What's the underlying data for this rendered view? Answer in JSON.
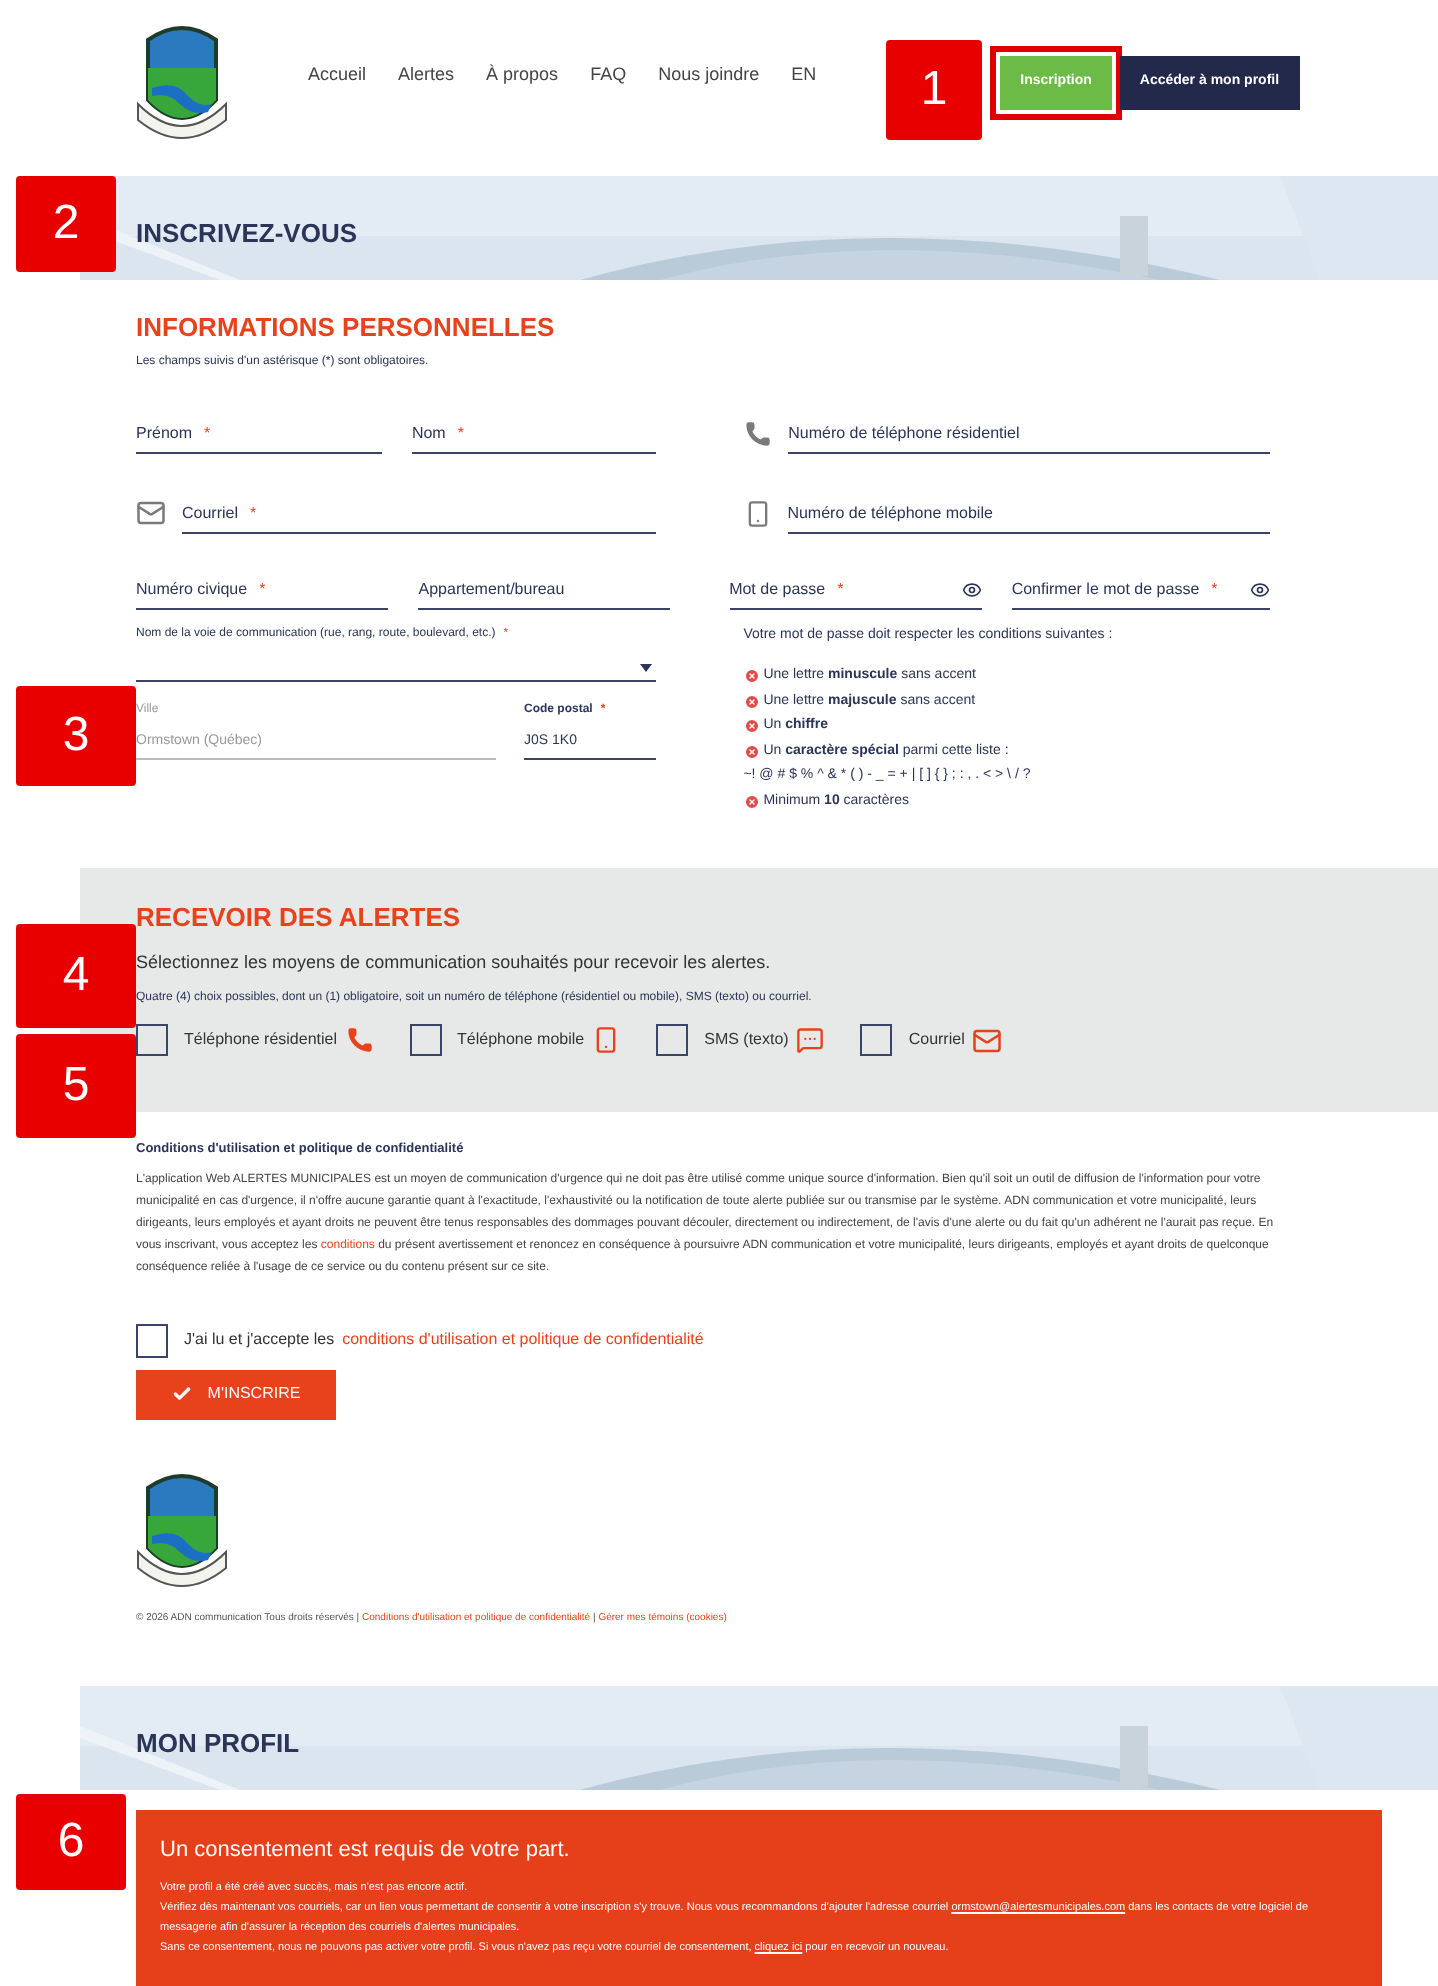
{
  "nav": {
    "items": [
      "Accueil",
      "Alertes",
      "À propos",
      "FAQ",
      "Nous joindre",
      "EN"
    ],
    "buttons": [
      {
        "label": "Inscription",
        "kind": "primary"
      },
      {
        "label": "Accéder à mon profil",
        "kind": "dark"
      }
    ]
  },
  "callouts": [
    "1",
    "2",
    "3",
    "4",
    "5",
    "6"
  ],
  "signup_banner": {
    "title": "INSCRIVEZ-VOUS"
  },
  "personal": {
    "title": "INFORMATIONS PERSONNELLES",
    "note": "Les champs suivis d'un astérisque (*) sont obligatoires.",
    "fields": [
      {
        "label": "Prénom",
        "mark": "*"
      },
      {
        "label": "Nom",
        "mark": "*"
      },
      {
        "label": "Numéro de téléphone résidentiel"
      },
      {
        "label": "Courriel",
        "mark": "*"
      },
      {
        "label": "Numéro de téléphone mobile"
      },
      {
        "label": "Numéro civique",
        "mark": "*"
      },
      {
        "label": "Appartement/bureau"
      },
      {
        "label": "Mot de passe",
        "mark": "*"
      },
      {
        "label": "Confirmer le mot de passe",
        "mark": "*"
      }
    ],
    "street": {
      "label": "Nom de la voie de communication (rue, rang, route, boulevard, etc.)",
      "mark": "*"
    },
    "city": {
      "label": "Ville",
      "value": "Ormstown (Québec)",
      "disabled": true
    },
    "postal": {
      "label": "Code postal",
      "mark": "*",
      "value": "J0S 1K0",
      "disabled": false
    },
    "password_rules": {
      "title": "Votre mot de passe doit respecter les conditions suivantes :",
      "rules": [
        {
          "text": "Une lettre **minuscule** sans accent"
        },
        {
          "text": "Une lettre **majuscule** sans accent"
        },
        {
          "text": "Un **chiffre**"
        },
        {
          "text": "Un **caractère spécial** parmi cette liste :",
          "extra": "~! @ # $ % ^ & * ( ) - _ = + | [ ] { } ; : , . < > \\ / ?"
        },
        {
          "text": "Minimum **10** caractères"
        }
      ]
    }
  },
  "alerts": {
    "title": "RECEVOIR DES ALERTES",
    "intro": "Sélectionnez les moyens de communication souhaités pour recevoir les alertes.",
    "note": "Quatre (4) choix possibles, dont un (1) obligatoire, soit un numéro de téléphone (résidentiel ou mobile), SMS (texto) ou courriel.",
    "options": [
      {
        "label": "Téléphone résidentiel",
        "checked": false
      },
      {
        "label": "Téléphone mobile",
        "checked": false
      },
      {
        "label": "SMS (texto)",
        "checked": false
      },
      {
        "label": "Courriel",
        "checked": false
      }
    ]
  },
  "terms": {
    "title": "Conditions d'utilisation et politique de confidentialité",
    "paragraph": [
      {
        "kind": "text",
        "text": "L'application Web ALERTES MUNICIPALES est un moyen de communication d'urgence qui ne doit pas être utilisé comme unique source d'information. Bien qu'il soit un outil de diffusion de l'information pour votre municipalité en cas d'urgence, il n'offre aucune garantie quant à l'exactitude, l'exhaustivité ou la notification de toute alerte publiée sur ou transmise par le système. ADN communication et votre municipalité, leurs dirigeants, leurs employés et ayant droits ne peuvent être tenus responsables des dommages pouvant découler, directement ou indirectement, de l'avis d'une alerte ou du fait qu'un adhérent ne l'aurait pas reçue. En vous inscrivant, vous acceptez les "
      },
      {
        "kind": "link",
        "text": "conditions"
      },
      {
        "kind": "text",
        "text": " du présent avertissement et renoncez en conséquence à poursuivre ADN communication et votre municipalité, leurs dirigeants, employés et ayant droits de quelconque conséquence reliée à l'usage de ce service ou du contenu présent sur ce site."
      }
    ],
    "accept": {
      "label": "J'ai lu et j'accepte les",
      "link": "conditions d'utilisation et politique de confidentialité",
      "checked": false
    },
    "submit": "M'INSCRIRE"
  },
  "footer": {
    "copyright": "© 2026 ADN communication Tous droits réservés |",
    "links": [
      "Conditions d'utilisation et politique de confidentialité",
      "Gérer mes témoins (cookies)"
    ],
    "separator": "|"
  },
  "profile_banner": {
    "title": "MON PROFIL"
  },
  "consent": {
    "title": "Un consentement est requis de votre part.",
    "lines": [
      [
        {
          "kind": "text",
          "text": "Votre profil a été créé avec succès, mais n'est pas encore actif."
        }
      ],
      [
        {
          "kind": "text",
          "text": "Vérifiez dès maintenant vos courriels, car un lien vous permettant de consentir à votre inscription s'y trouve. Nous vous recommandons d'ajouter l'adresse courriel "
        },
        {
          "kind": "link",
          "text": "ormstown@alertesmunicipales.com"
        },
        {
          "kind": "text",
          "text": " dans les contacts de votre logiciel de messagerie afin d'assurer la réception des courriels d'alertes municipales."
        }
      ],
      [
        {
          "kind": "text",
          "text": "Sans ce consentement, nous ne pouvons pas activer votre profil. Si vous n'avez pas reçu votre courriel de consentement, "
        },
        {
          "kind": "link",
          "text": "cliquez ici"
        },
        {
          "kind": "text",
          "text": " pour en recevoir un nouveau."
        }
      ]
    ]
  }
}
